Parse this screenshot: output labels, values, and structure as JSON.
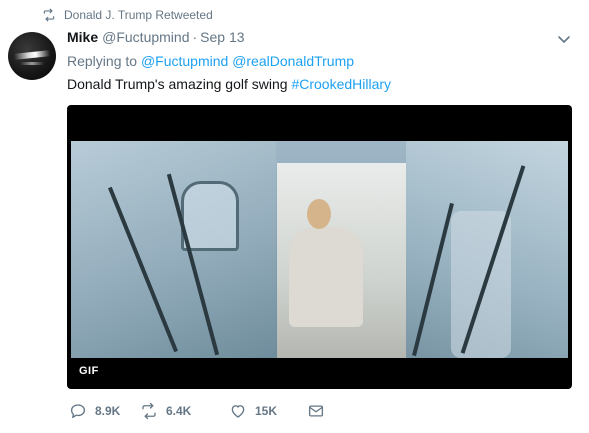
{
  "retweet_context": {
    "icon": "retweet-icon",
    "text": "Donald J. Trump Retweeted"
  },
  "tweet": {
    "author_name": "Mike",
    "author_handle": "@Fuctupmind",
    "separator": "·",
    "timestamp": "Sep 13",
    "replying_prefix": "Replying to",
    "replying_to": [
      "@Fuctupmind",
      "@realDonaldTrump"
    ],
    "text": "Donald Trump's amazing golf swing",
    "hashtag": "#CrookedHillary",
    "media_badge": "GIF"
  },
  "actions": {
    "reply_count": "8.9K",
    "retweet_count": "6.4K",
    "like_count": "15K"
  },
  "colors": {
    "link": "#1da1f2",
    "secondary_text": "#657786",
    "primary_text": "#14171a"
  }
}
